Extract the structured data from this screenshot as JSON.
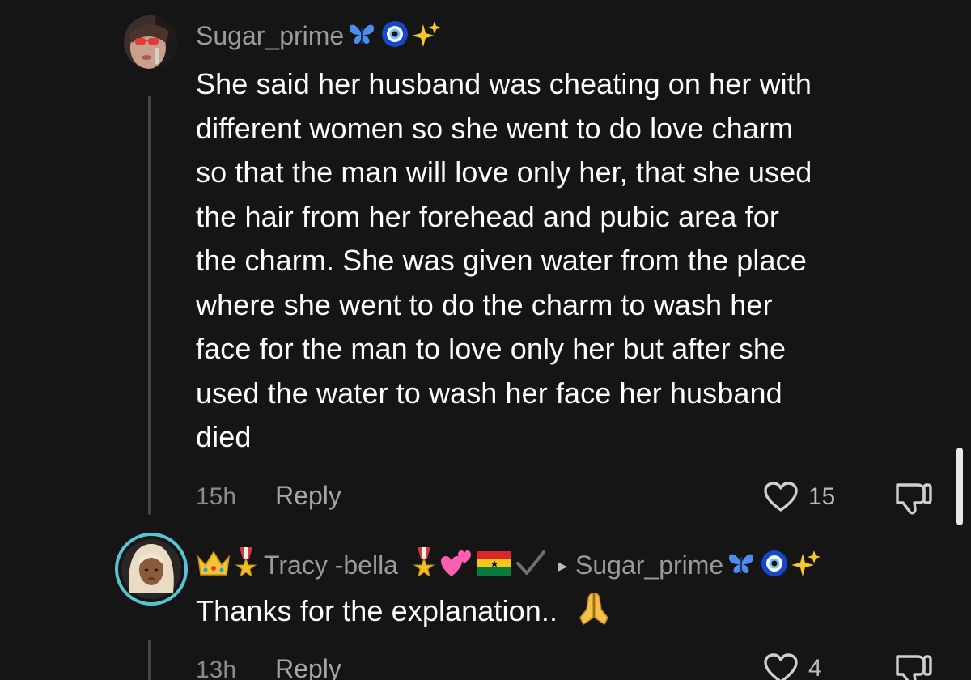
{
  "comments": [
    {
      "username": "Sugar_prime",
      "username_emojis": [
        "butterfly-emoji",
        "nazar-amulet-emoji",
        "sparkles-emoji"
      ],
      "text_lines": [
        "She said her husband was cheating on her with",
        "different women so she went to do love charm",
        "so that the man will love only her, that she used",
        "the hair from her forehead and pubic area for",
        "the charm. She was given water from the place",
        "where she went to do the charm to wash her",
        "face for the man to love only her but after she",
        "used the water to wash her face her husband",
        "died"
      ],
      "time": "15h",
      "reply_label": "Reply",
      "likes": "15"
    },
    {
      "username": "Tracy -bella",
      "username_prefix_emojis": [
        "crown-emoji",
        "military-medal-emoji"
      ],
      "username_suffix_emojis": [
        "military-medal-emoji",
        "two-hearts-emoji",
        "ghana-flag-emoji",
        "check-mark-emoji"
      ],
      "reply_to_arrow": "▸",
      "reply_to": "Sugar_prime",
      "reply_to_emojis": [
        "butterfly-emoji",
        "nazar-amulet-emoji",
        "sparkles-emoji"
      ],
      "text": "Thanks for the explanation..",
      "text_emoji": "folded-hands-emoji",
      "time": "13h",
      "reply_label": "Reply",
      "likes": "4"
    }
  ],
  "colors": {
    "background": "#151515",
    "username": "#9a9a9a",
    "body_text": "#ffffff",
    "meta_text": "#8a8a8a",
    "avatar_ring": "#56c4d2"
  }
}
